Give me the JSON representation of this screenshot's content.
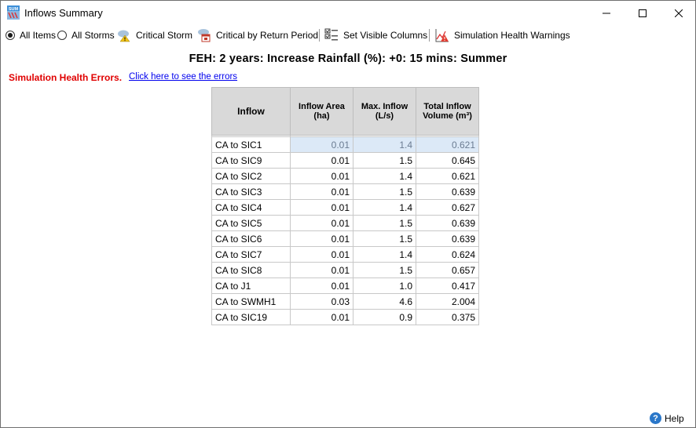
{
  "window": {
    "title": "Inflows Summary",
    "app_icon_text": "SUM"
  },
  "toolbar": {
    "all_items": "All Items",
    "all_storms": "All Storms",
    "critical_storm": "Critical Storm",
    "critical_return": "Critical by Return Period",
    "set_columns": "Set Visible Columns",
    "health_warnings": "Simulation Health Warnings",
    "selected_radio": "All Items"
  },
  "heading": "FEH: 2 years: Increase Rainfall (%): +0: 15 mins: Summer",
  "health": {
    "errors_label": "Simulation Health Errors.",
    "link_text": "Click here to see the errors"
  },
  "table": {
    "headers": [
      "Inflow",
      "Inflow Area\n(ha)",
      "Max. Inflow\n(L/s)",
      "Total Inflow\nVolume (m³)"
    ],
    "rows": [
      [
        "CA to SIC1",
        "0.01",
        "1.4",
        "0.621"
      ],
      [
        "CA to SIC9",
        "0.01",
        "1.5",
        "0.645"
      ],
      [
        "CA to SIC2",
        "0.01",
        "1.4",
        "0.621"
      ],
      [
        "CA to SIC3",
        "0.01",
        "1.5",
        "0.639"
      ],
      [
        "CA to SIC4",
        "0.01",
        "1.4",
        "0.627"
      ],
      [
        "CA to SIC5",
        "0.01",
        "1.5",
        "0.639"
      ],
      [
        "CA to SIC6",
        "0.01",
        "1.5",
        "0.639"
      ],
      [
        "CA to SIC7",
        "0.01",
        "1.4",
        "0.624"
      ],
      [
        "CA to SIC8",
        "0.01",
        "1.5",
        "0.657"
      ],
      [
        "CA to J1",
        "0.01",
        "1.0",
        "0.417"
      ],
      [
        "CA to SWMH1",
        "0.03",
        "4.6",
        "2.004"
      ],
      [
        "CA to SIC19",
        "0.01",
        "0.9",
        "0.375"
      ]
    ],
    "selected_row": 0
  },
  "footer": {
    "help": "Help"
  },
  "colors": {
    "error_red": "#e00000",
    "link_blue": "#0000ee",
    "header_gray": "#d9d9d9",
    "selection": "#dce9f7"
  }
}
